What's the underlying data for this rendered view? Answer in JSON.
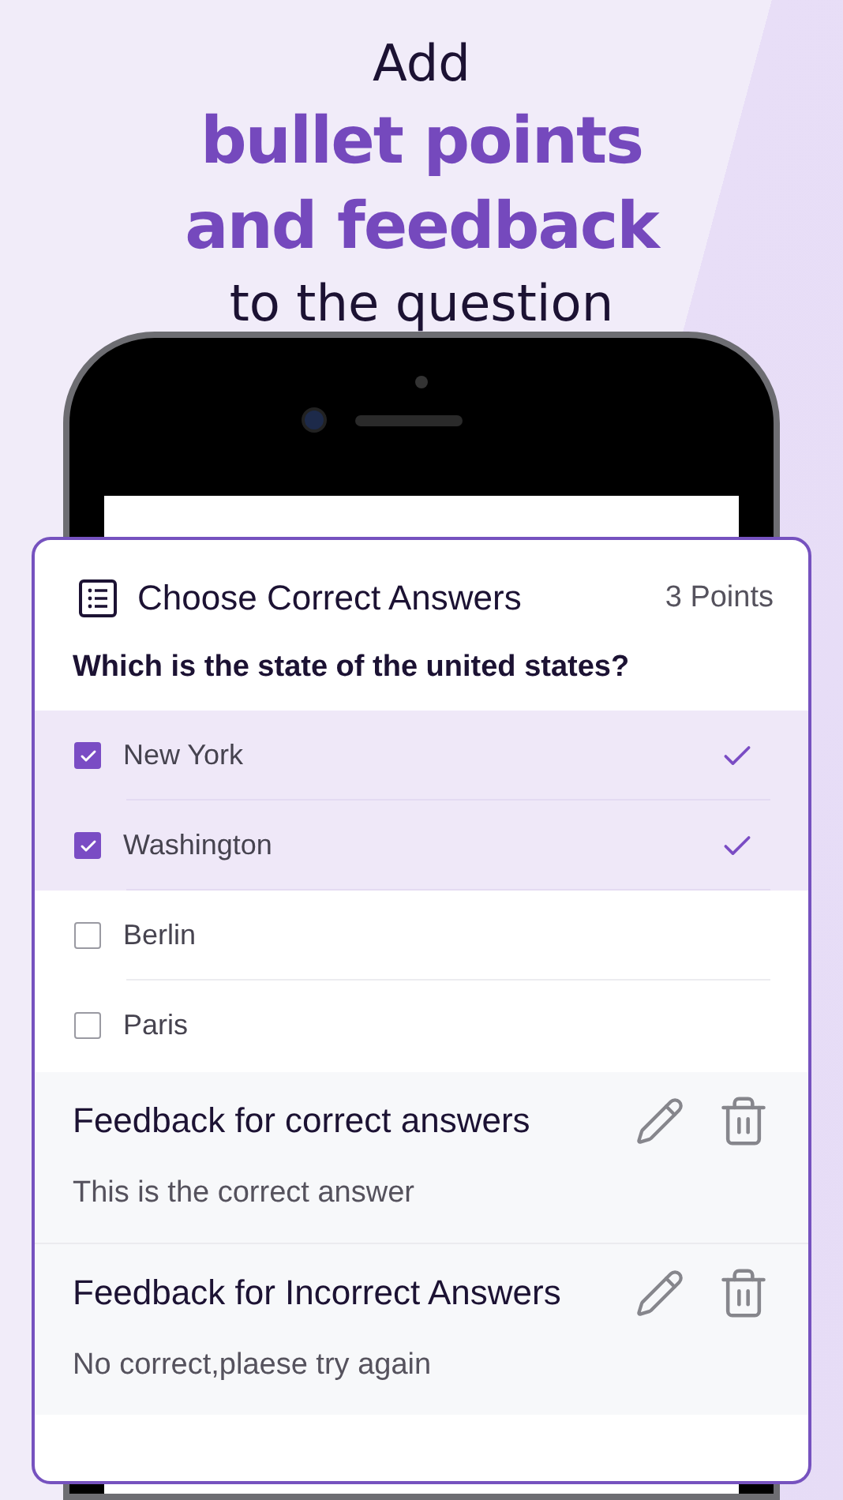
{
  "headline": {
    "lines": [
      {
        "text": "Add",
        "kind": "plain"
      },
      {
        "text": "bullet points",
        "kind": "accent"
      },
      {
        "text": "and feedback",
        "kind": "accent"
      },
      {
        "text": "to the question",
        "kind": "plain"
      }
    ]
  },
  "card": {
    "title": "Choose Correct Answers",
    "points": "3 Points",
    "question": "Which is the state of the united states?",
    "options": [
      {
        "label": "New York",
        "checked": true,
        "correct": true
      },
      {
        "label": "Washington",
        "checked": true,
        "correct": true
      },
      {
        "label": "Berlin",
        "checked": false,
        "correct": false
      },
      {
        "label": "Paris",
        "checked": false,
        "correct": false
      }
    ],
    "feedback": [
      {
        "title": "Feedback for correct answers",
        "text": "This is the correct answer"
      },
      {
        "title": "Feedback for Incorrect Answers",
        "text": "No correct,plaese try again"
      }
    ]
  }
}
